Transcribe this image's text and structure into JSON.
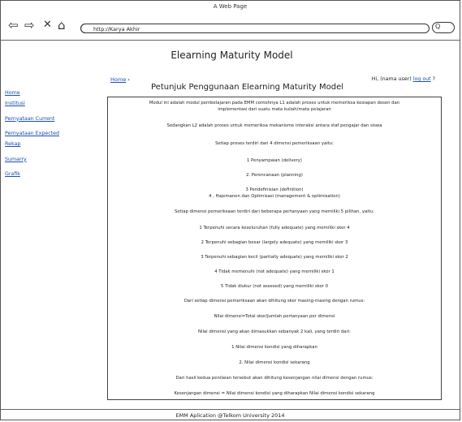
{
  "window": {
    "title": "A Web Page"
  },
  "browser": {
    "url": "http://Karya Akhir"
  },
  "header": {
    "title": "Elearning Maturity Model"
  },
  "breadcrumb": {
    "home": "Home",
    "separator": "›"
  },
  "user": {
    "greeting": "Hi, (nama user)",
    "logout": "log out",
    "help": "?"
  },
  "sidebar": {
    "items": [
      {
        "label": "Home"
      },
      {
        "label": "Institusi"
      },
      {
        "label": "Pernyataan Current"
      },
      {
        "label": "Pernyataan Expected"
      },
      {
        "label": "Rekap"
      },
      {
        "label": "Sumarry"
      },
      {
        "label": "Grafik"
      }
    ]
  },
  "section": {
    "title": "Petunjuk Penggunaan Elearning Maturity Model"
  },
  "content": {
    "paragraphs": [
      "Modul ini adalah modul pembelajaran pada EMM contohnya L1 adalah proses untuk memeriksa kesiapan dosen dan",
      "implementasi dari suatu mata kuliah/mata pelajaran",
      "Sedangkan L2 adalah proses untuk memeriksa mekanisme interaksi antara staf pengajar dan siswa",
      "Setiap proses terdiri dari 4 dimensi pemeriksaan yaitu:",
      "1 Penyampaian (delivery)",
      "2. Perencanaan (planning)",
      "3 Pendefinisian (definition)",
      "4 , Hajemanen dan Optimisasi (management & optimisation)",
      "Setiap dimensi pemeriksaan terdiri dari beberapa pertanyaan yang memiliki 5 pilihan, yaitu:",
      "1 Terpenuhi secara keseluruhan (fully adequate) yang memiliki skor 4",
      "2 Terpenuhi sebagian besar (largely adequate) yang memiliki skor 3",
      "3 Terpenuhi sebagian kecil (partially adequate) yang memiliki skor 2",
      "4 Tidak memenuhi (not adequate) yang memiliki skor 1",
      "5 Tidak diukur (not assesed) yang memiliki skor 0",
      "Dari setiap dimensi pemeriksaan akan dihitung skor masing-masing dengan rumus:",
      "Nilai dimensi=Total skor/Jumlah pertanyaan per dimensi",
      "Nilai dimensi yang akan dimasukkan sebanyak 2 kali, yang terdiri dari:",
      "1 Nilai dimensi kondisi yang diharapkan",
      "2. Nilai dimensi kondisi sekarang",
      "Dari hasil kedua penilaian tersebut akan dihitung kesenjangan nilai dimensi dengan rumus:",
      "Kesenjangan dimensi = Nilai dimensi kondisi yang diharapkan Nilai dimensi kondisi sekarang"
    ]
  },
  "footer": {
    "text": "EMM Aplication @Telkom University 2014"
  },
  "icons": {
    "back": "back-arrow-icon",
    "forward": "forward-arrow-icon",
    "close": "close-icon",
    "home": "home-icon",
    "search": "search-icon"
  }
}
